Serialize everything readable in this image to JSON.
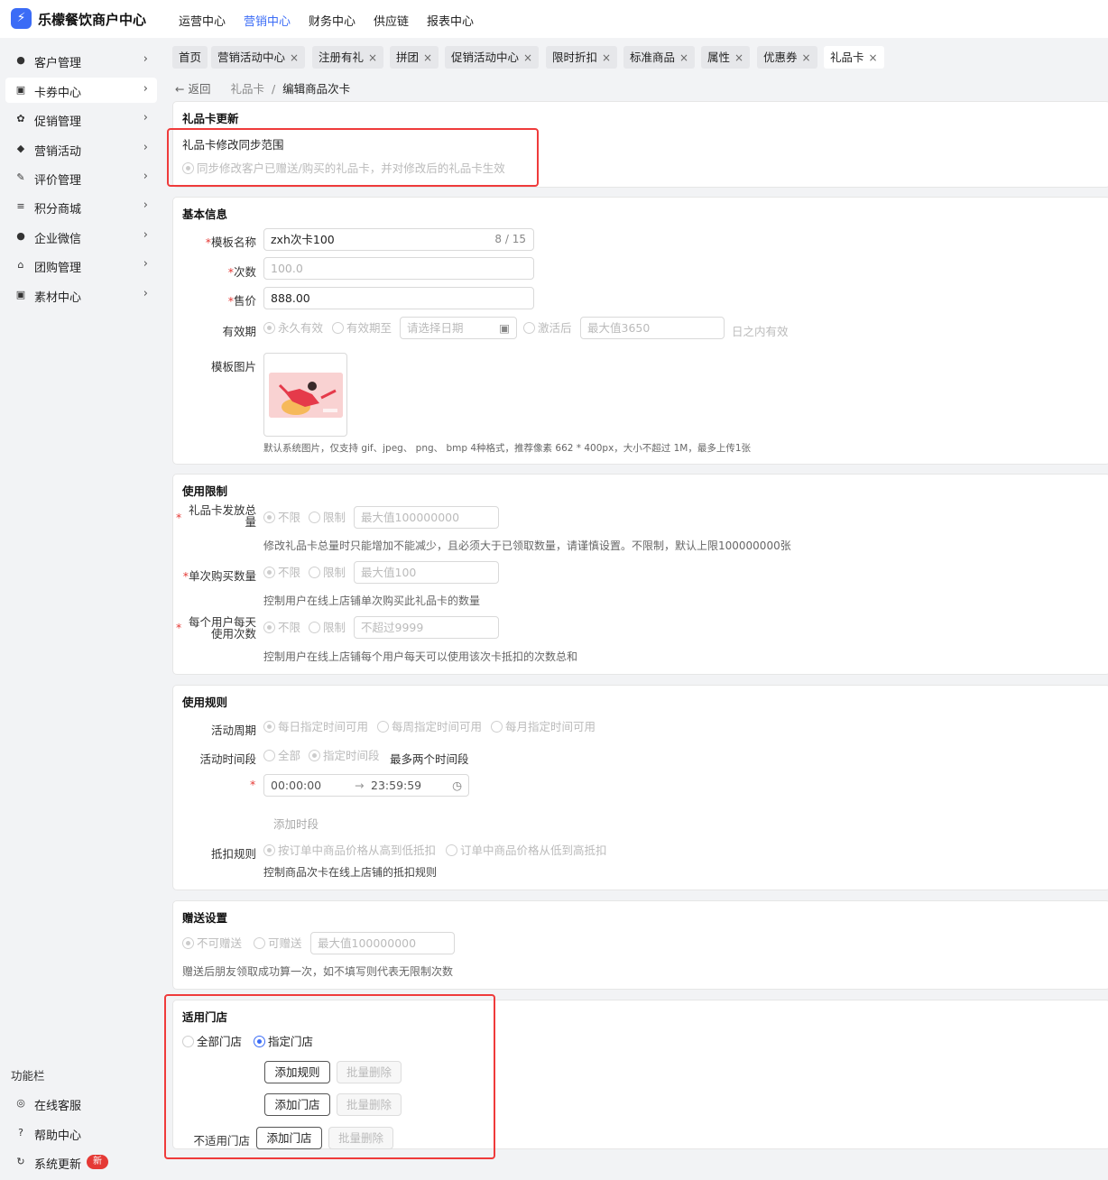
{
  "app": {
    "title": "乐檬餐饮商户中心",
    "logo_char": "⚡"
  },
  "topnav": [
    "运营中心",
    "营销中心",
    "财务中心",
    "供应链",
    "报表中心"
  ],
  "sidebar": {
    "items": [
      {
        "label": "客户管理",
        "icon": "user-icon",
        "glyph": "●"
      },
      {
        "label": "卡券中心",
        "icon": "card-icon",
        "glyph": "▣"
      },
      {
        "label": "促销管理",
        "icon": "promo-icon",
        "glyph": "✿"
      },
      {
        "label": "营销活动",
        "icon": "tag-icon",
        "glyph": "◆"
      },
      {
        "label": "评价管理",
        "icon": "review-icon",
        "glyph": "✎"
      },
      {
        "label": "积分商城",
        "icon": "coin-icon",
        "glyph": "≡"
      },
      {
        "label": "企业微信",
        "icon": "chat-icon",
        "glyph": "●"
      },
      {
        "label": "团购管理",
        "icon": "store-icon",
        "glyph": "⌂"
      },
      {
        "label": "素材中心",
        "icon": "image-icon",
        "glyph": "▣"
      }
    ],
    "arrow": "›",
    "footer_title": "功能栏",
    "footer": [
      {
        "label": "在线客服",
        "glyph": "◎"
      },
      {
        "label": "帮助中心",
        "glyph": "?"
      },
      {
        "label": "系统更新",
        "glyph": "↻",
        "badge": "新"
      }
    ]
  },
  "tabs": [
    {
      "label": "首页",
      "closable": false
    },
    {
      "label": "营销活动中心",
      "closable": true
    },
    {
      "label": "注册有礼",
      "closable": true
    },
    {
      "label": "拼团",
      "closable": true
    },
    {
      "label": "促销活动中心",
      "closable": true
    },
    {
      "label": "限时折扣",
      "closable": true
    },
    {
      "label": "标准商品",
      "closable": true
    },
    {
      "label": "属性",
      "closable": true
    },
    {
      "label": "优惠券",
      "closable": true
    },
    {
      "label": "礼品卡",
      "closable": true
    }
  ],
  "tab_close": "×",
  "breadcrumb": {
    "back": "← 返回",
    "parent": "礼品卡",
    "sep": "/",
    "current": "编辑商品次卡"
  },
  "update": {
    "title": "礼品卡更新",
    "label": "礼品卡修改同步范围",
    "option": "同步修改客户已赠送/购买的礼品卡，并对修改后的礼品卡生效"
  },
  "basic": {
    "title": "基本信息",
    "name_label": "模板名称",
    "name_value": "zxh次卡100",
    "name_count": "8 / 15",
    "times_label": "次数",
    "times_placeholder": "100.0",
    "price_label": "售价",
    "price_value": "888.00",
    "validity_label": "有效期",
    "validity_options": [
      "永久有效",
      "有效期至",
      "激活后"
    ],
    "date_placeholder": "请选择日期",
    "days_placeholder": "最大值3650",
    "days_suffix": "日之内有效",
    "image_label": "模板图片",
    "image_hint": "默认系统图片，仅支持 gif、jpeg、 png、 bmp 4种格式，推荐像素 662 * 400px，大小不超过 1M，最多上传1张"
  },
  "limits": {
    "title": "使用限制",
    "total_label_1": "礼品卡发放总",
    "total_label_2": "量",
    "opt_unlimited": "不限",
    "opt_limited": "限制",
    "total_placeholder": "最大值100000000",
    "total_hint": "修改礼品卡总量时只能增加不能减少，且必须大于已领取数量，请谨慎设置。不限制，默认上限100000000张",
    "single_label": "单次购买数量",
    "single_placeholder": "最大值100",
    "single_hint": "控制用户在线上店铺单次购买此礼品卡的数量",
    "daily_label_1": "每个用户每天",
    "daily_label_2": "使用次数",
    "daily_placeholder": "不超过9999",
    "daily_hint": "控制用户在线上店铺每个用户每天可以使用该次卡抵扣的次数总和"
  },
  "rules": {
    "title": "使用规则",
    "cycle_label": "活动周期",
    "cycle_options": [
      "每日指定时间可用",
      "每周指定时间可用",
      "每月指定时间可用"
    ],
    "period_label": "活动时间段",
    "period_options": [
      "全部",
      "指定时间段"
    ],
    "period_note": "最多两个时间段",
    "time_start": "00:00:00",
    "time_arrow": "→",
    "time_end": "23:59:59",
    "add_period": "添加时段",
    "deduct_label": "抵扣规则",
    "deduct_options": [
      "按订单中商品价格从高到低抵扣",
      "订单中商品价格从低到高抵扣"
    ],
    "deduct_hint": "控制商品次卡在线上店铺的抵扣规则"
  },
  "gift": {
    "title": "赠送设置",
    "options": [
      "不可赠送",
      "可赠送"
    ],
    "placeholder": "最大值100000000",
    "hint": "赠送后朋友领取成功算一次，如不填写则代表无限制次数"
  },
  "stores": {
    "title": "适用门店",
    "options": [
      "全部门店",
      "指定门店"
    ],
    "add_rule": "添加规则",
    "batch_delete": "批量删除",
    "add_store": "添加门店",
    "excluded_label": "不适用门店"
  },
  "colors": {
    "accent": "#3b6cf6",
    "highlight": "#ef3b3b",
    "required": "#e53935"
  }
}
